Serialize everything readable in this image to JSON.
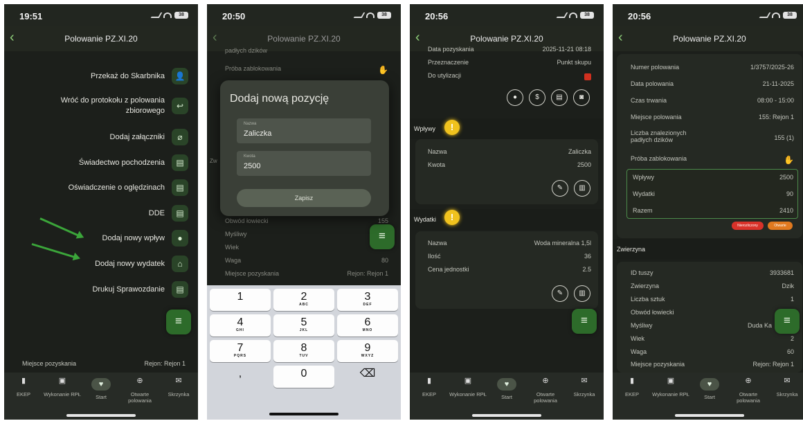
{
  "colors": {
    "accent": "#2d6b2a",
    "arrow": "#3ba53a",
    "warning": "#f0c21e",
    "danger": "#e0412a",
    "background": "#1c1f1b"
  },
  "nav_title": "Polowanie PZ.XI.20",
  "tabs": [
    "EKEP",
    "Wykonanie RPŁ",
    "Start",
    "Otwarte polowania",
    "Skrzynka"
  ],
  "panel1": {
    "time": "19:51",
    "battery": "38",
    "menu": [
      {
        "label": "Przekaż do Skarbnika",
        "icon": "user-transfer-icon"
      },
      {
        "label": "Wróć do protokołu z polowania zbiorowego",
        "icon": "return-icon"
      },
      {
        "label": "Dodaj załączniki",
        "icon": "paperclip-icon"
      },
      {
        "label": "Świadectwo pochodzenia",
        "icon": "document-icon"
      },
      {
        "label": "Oświadczenie o oględzinach",
        "icon": "document-icon"
      },
      {
        "label": "DDE",
        "icon": "document-icon"
      },
      {
        "label": "Dodaj nowy wpływ",
        "icon": "piggy-bank-icon"
      },
      {
        "label": "Dodaj nowy wydatek",
        "icon": "basket-icon"
      },
      {
        "label": "Drukuj Sprawozdanie",
        "icon": "document-icon"
      }
    ],
    "footer_row": {
      "label": "Miejsce pozyskania",
      "value": "Rejon: Rejon 1"
    }
  },
  "panel2": {
    "time": "20:50",
    "battery": "38",
    "bg_rows": [
      {
        "label": "padłych dzików",
        "value": ""
      },
      {
        "label": "Próba zablokowania",
        "value": ""
      },
      {
        "label": "Obwód łowiecki",
        "value": "155"
      },
      {
        "label": "Myśliwy",
        "value": ""
      },
      {
        "label": "Wiek",
        "value": ""
      },
      {
        "label": "Waga",
        "value": "80"
      },
      {
        "label": "Miejsce pozyskania",
        "value": "Rejon: Rejon 1"
      }
    ],
    "side_letter": "Zw",
    "modal": {
      "title": "Dodaj nową pozycję",
      "name_label": "Nazwa",
      "name_value": "Zaliczka",
      "amount_label": "Kwota",
      "amount_value": "2500",
      "save": "Zapisz"
    },
    "keys": [
      {
        "d": "1",
        "l": ""
      },
      {
        "d": "2",
        "l": "ABC"
      },
      {
        "d": "3",
        "l": "DEF"
      },
      {
        "d": "4",
        "l": "GHI"
      },
      {
        "d": "5",
        "l": "JKL"
      },
      {
        "d": "6",
        "l": "MNO"
      },
      {
        "d": "7",
        "l": "PQRS"
      },
      {
        "d": "8",
        "l": "TUV"
      },
      {
        "d": "9",
        "l": "WXYZ"
      },
      {
        "d": ",",
        "l": ""
      },
      {
        "d": "0",
        "l": ""
      },
      {
        "d": "⌫",
        "l": ""
      }
    ]
  },
  "panel3": {
    "time": "20:56",
    "battery": "38",
    "top_rows": [
      {
        "label": "Data pozyskania",
        "value": "2025-11-21 08:18"
      },
      {
        "label": "Przeznaczenie",
        "value": "Punkt skupu"
      },
      {
        "label": "Do utylizacji",
        "value": ""
      }
    ],
    "income_title": "Wpływy",
    "income_rows": [
      {
        "label": "Nazwa",
        "value": "Zaliczka"
      },
      {
        "label": "Kwota",
        "value": "2500"
      }
    ],
    "expense_title": "Wydatki",
    "expense_rows": [
      {
        "label": "Nazwa",
        "value": "Woda mineralna 1,5l"
      },
      {
        "label": "Ilość",
        "value": "36"
      },
      {
        "label": "Cena jednostki",
        "value": "2.5"
      }
    ]
  },
  "panel4": {
    "time": "20:56",
    "battery": "38",
    "rows": [
      {
        "label": "Numer polowania",
        "value": "1/3757/2025-26"
      },
      {
        "label": "Data polowania",
        "value": "21-11-2025"
      },
      {
        "label": "Czas trwania",
        "value": "08:00 - 15:00"
      },
      {
        "label": "Miejsce polowania",
        "value": "155: Rejon 1"
      },
      {
        "label": "Liczba znalezionych padłych dzików",
        "value": "155 (1)"
      },
      {
        "label": "Próba zablokowania",
        "value": ""
      }
    ],
    "summary": [
      {
        "label": "Wpływy",
        "value": "2500"
      },
      {
        "label": "Wydatki",
        "value": "90"
      },
      {
        "label": "Razem",
        "value": "2410"
      }
    ],
    "badges": [
      "Nierozliczony",
      "Otwarte"
    ],
    "game_title": "Zwierzyna",
    "game_rows": [
      {
        "label": "ID tuszy",
        "value": "3933681"
      },
      {
        "label": "Zwierzyna",
        "value": "Dzik"
      },
      {
        "label": "Liczba sztuk",
        "value": "1"
      },
      {
        "label": "Obwód łowiecki",
        "value": ""
      },
      {
        "label": "Myśliwy",
        "value": "Duda Ka"
      },
      {
        "label": "Wiek",
        "value": "2"
      },
      {
        "label": "Waga",
        "value": "60"
      },
      {
        "label": "Miejsce pozyskania",
        "value": "Rejon: Rejon 1"
      }
    ]
  }
}
